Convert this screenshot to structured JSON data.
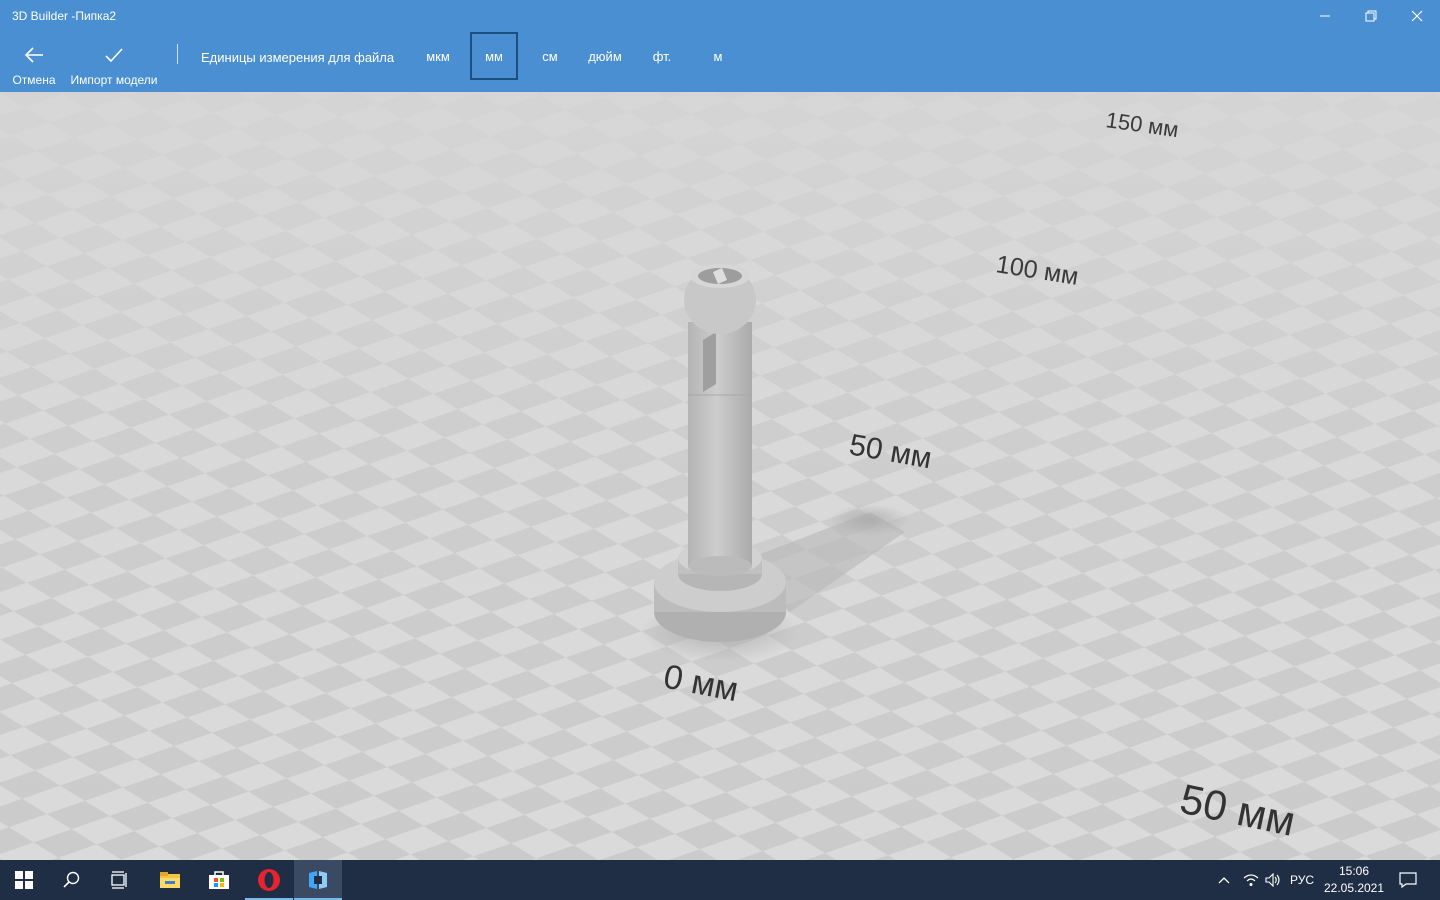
{
  "window": {
    "title": "3D Builder -Пипка2"
  },
  "command_bar": {
    "cancel_label": "Отмена",
    "import_label": "Импорт модели",
    "units_label": "Единицы измерения для файла",
    "units": [
      "мкм",
      "мм",
      "см",
      "дюйм",
      "фт.",
      "м"
    ],
    "selected_unit": "мм"
  },
  "viewport": {
    "ruler_labels": [
      "150 мм",
      "100 мм",
      "50 мм",
      "0 мм",
      "50 мм"
    ]
  },
  "taskbar": {
    "language": "РУС",
    "time": "15:06",
    "date": "22.05.2021"
  },
  "colors": {
    "accent": "#4a8fd1",
    "taskbar": "#1f2e45",
    "floor_light": "#dcdcdc",
    "floor_dark": "#c9c9c9",
    "model": "#c2c2c2"
  }
}
